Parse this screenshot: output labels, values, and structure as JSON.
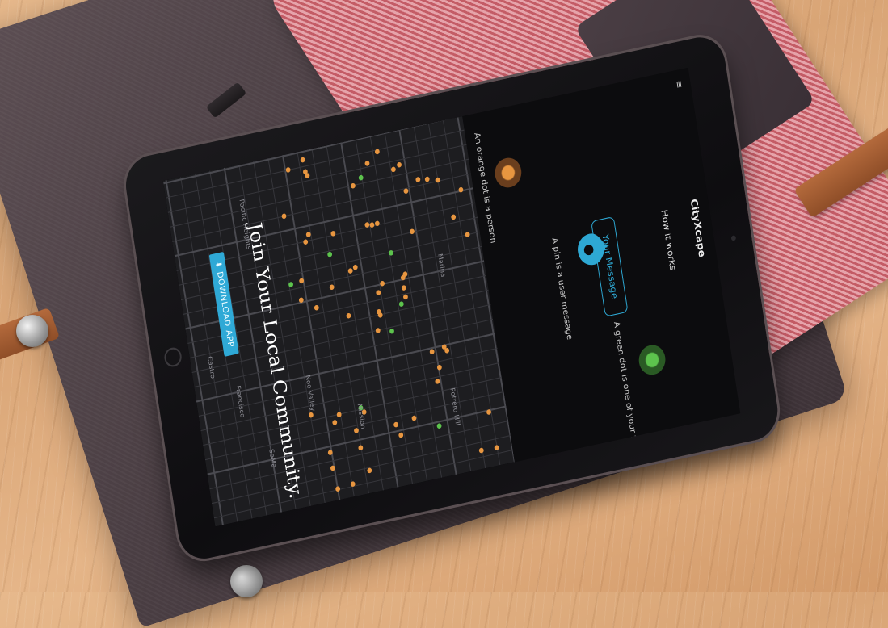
{
  "app": {
    "brand": "CityXcape",
    "menu_icon": "hamburger-icon"
  },
  "hero": {
    "title": "Join Your Local Community.",
    "download_button": "⬇ DOWNLOAD APP"
  },
  "map_labels": [
    "Francisco",
    "SoMa",
    "Pacific Heights",
    "Castro",
    "Mission",
    "Noe Valley",
    "Potrero Hill",
    "Marina"
  ],
  "how_it_works": {
    "heading": "How it works",
    "orange_caption": "An orange dot is a person",
    "pin_caption": "A pin is a user message",
    "bubble_text": "Your Message",
    "green_caption": "A green dot is one of your friends"
  },
  "colors": {
    "accent": "#2fa9d6",
    "orange_dot": "#e89640",
    "green_dot": "#5dc34d",
    "map_bg": "#1d1d20"
  }
}
